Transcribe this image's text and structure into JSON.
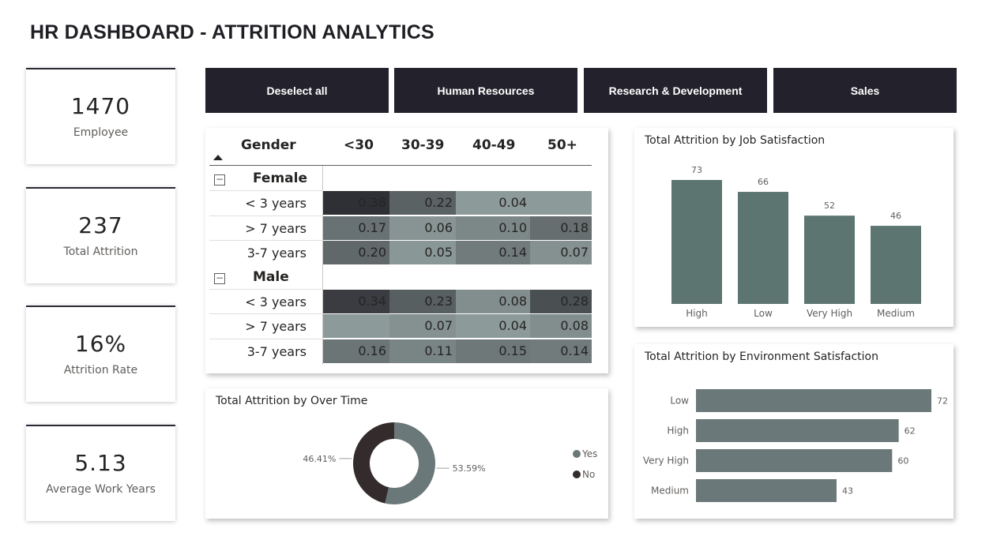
{
  "title": "HR DASHBOARD - ATTRITION ANALYTICS",
  "kpis": [
    {
      "value": "1470",
      "label": "Employee"
    },
    {
      "value": "237",
      "label": "Total Attrition"
    },
    {
      "value": "16%",
      "label": "Attrition Rate"
    },
    {
      "value": "5.13",
      "label": "Average Work Years"
    }
  ],
  "slicers": [
    "Deselect all",
    "Human Resources",
    "Research & Development",
    "Sales"
  ],
  "matrix": {
    "row_header": "Gender",
    "columns": [
      "<30",
      "30-39",
      "40-49",
      "50+"
    ],
    "groups": [
      {
        "name": "Female",
        "toggle": "−",
        "rows": [
          {
            "label": "< 3 years",
            "values": [
              "0.38",
              "0.22",
              "0.04",
              ""
            ]
          },
          {
            "label": "> 7 years",
            "values": [
              "0.17",
              "0.06",
              "0.10",
              "0.18"
            ]
          },
          {
            "label": "3-7 years",
            "values": [
              "0.20",
              "0.05",
              "0.14",
              "0.07"
            ]
          }
        ]
      },
      {
        "name": "Male",
        "toggle": "−",
        "rows": [
          {
            "label": "< 3 years",
            "values": [
              "0.34",
              "0.23",
              "0.08",
              "0.28"
            ]
          },
          {
            "label": "> 7 years",
            "values": [
              "",
              "0.07",
              "0.04",
              "0.08"
            ]
          },
          {
            "label": "3-7 years",
            "values": [
              "0.16",
              "0.11",
              "0.15",
              "0.14"
            ]
          }
        ]
      }
    ],
    "colors": {
      "dark": "#2f3035",
      "light": "#8c9a99"
    }
  },
  "chart_data": [
    {
      "type": "bar",
      "title": "Total Attrition by Job Satisfaction",
      "categories": [
        "High",
        "Low",
        "Very High",
        "Medium"
      ],
      "values": [
        73,
        66,
        52,
        46
      ],
      "ylim": [
        0,
        80
      ],
      "color": "#5c7570"
    },
    {
      "type": "bar",
      "orientation": "horizontal",
      "title": "Total Attrition by Environment Satisfaction",
      "categories": [
        "Low",
        "High",
        "Very High",
        "Medium"
      ],
      "values": [
        72,
        62,
        60,
        43
      ],
      "xlim": [
        0,
        72
      ],
      "color": "#6b7879"
    },
    {
      "type": "pie",
      "title": "Total Attrition by Over Time",
      "categories": [
        "Yes",
        "No"
      ],
      "values": [
        53.59,
        46.41
      ],
      "labels": [
        "53.59%",
        "46.41%"
      ],
      "colors": [
        "#6b7879",
        "#342c2c"
      ]
    }
  ]
}
